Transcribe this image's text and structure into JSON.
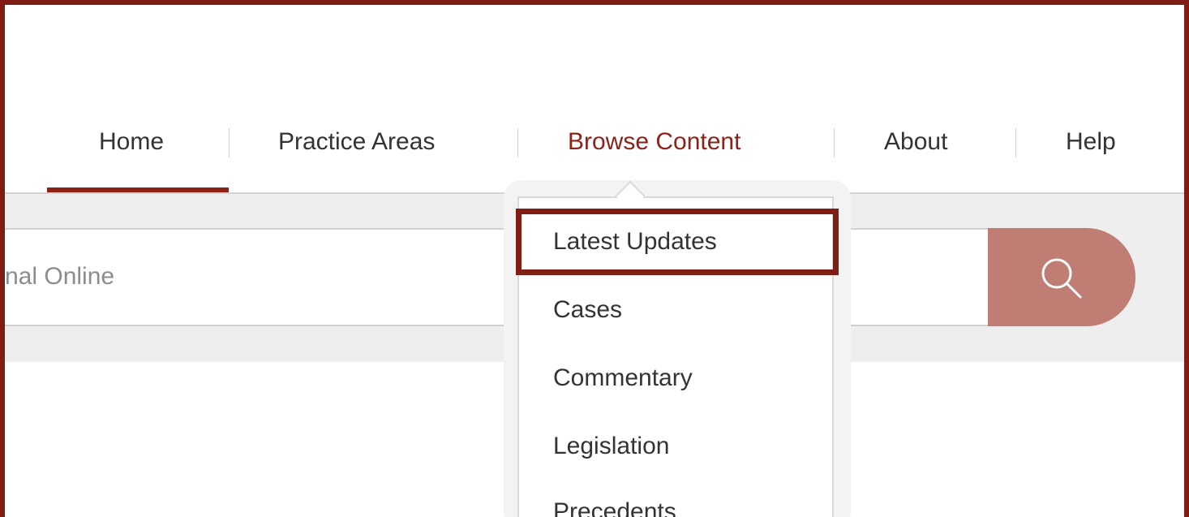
{
  "nav": {
    "items": [
      {
        "label": "Home"
      },
      {
        "label": "Practice Areas"
      },
      {
        "label": "Browse Content"
      },
      {
        "label": "About"
      },
      {
        "label": "Help"
      }
    ]
  },
  "search": {
    "visible_text": "nal Online",
    "button_icon": "search-icon"
  },
  "dropdown": {
    "items": [
      {
        "label": "Latest Updates"
      },
      {
        "label": "Cases"
      },
      {
        "label": "Commentary"
      },
      {
        "label": "Legislation"
      },
      {
        "label": "Precedents"
      }
    ]
  },
  "colors": {
    "brand": "#8b2318",
    "search_button": "#c07d73",
    "highlight_border": "#7f1d14"
  }
}
